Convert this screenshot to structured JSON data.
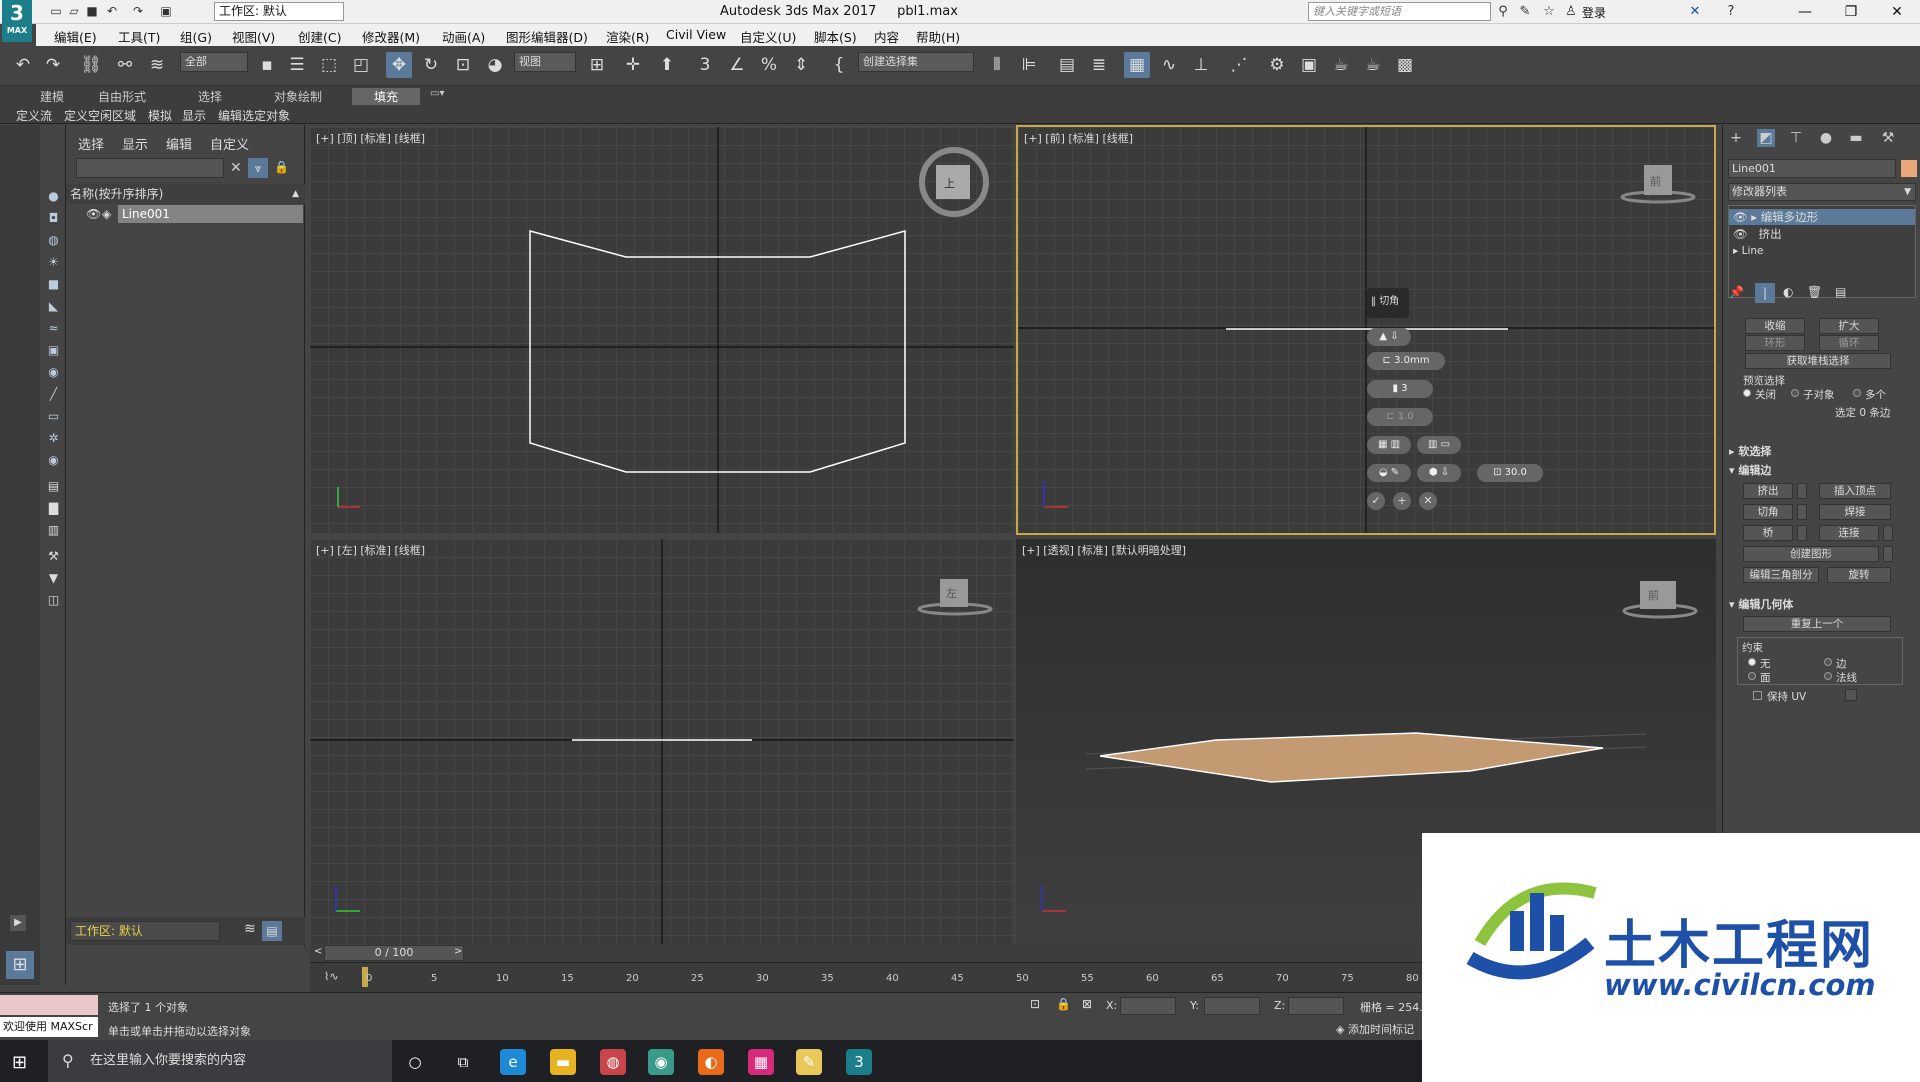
{
  "app": {
    "icon_text": "3",
    "icon_sub": "MAX",
    "title": "Autodesk 3ds Max 2017",
    "file": "pbl1.max",
    "workspace": "工作区: 默认",
    "search_placeholder": "键入关键字或短语",
    "login": "登录"
  },
  "menu": [
    "编辑(E)",
    "工具(T)",
    "组(G)",
    "视图(V)",
    "创建(C)",
    "修改器(M)",
    "动画(A)",
    "图形编辑器(D)",
    "渲染(R)",
    "Civil View",
    "自定义(U)",
    "脚本(S)",
    "内容",
    "帮助(H)"
  ],
  "toolbar": {
    "filter": "全部",
    "ref_coord": "视图",
    "named_sel": "创建选择集"
  },
  "ribbon_tabs": [
    "建模",
    "自由形式",
    "选择",
    "对象绘制",
    "填充"
  ],
  "ribbon_active": "填充",
  "ribbon_items": [
    "定义流",
    "定义空闲区域",
    "模拟",
    "显示",
    "编辑选定对象"
  ],
  "scene": {
    "tabs": [
      "选择",
      "显示",
      "编辑",
      "自定义"
    ],
    "header": "名称(按升序排序)",
    "object": "Line001",
    "workspace": "工作区: 默认"
  },
  "viewports": {
    "top": "[+] [顶] [标准] [线框]",
    "front": "[+] [前] [标准] [线框]",
    "left": "[+] [左] [标准] [线框]",
    "persp": "[+] [透视] [标准] [默认明暗处理]",
    "cube_top": "上",
    "cube_front": "前",
    "cube_left": "左",
    "cube_persp": "前"
  },
  "caddy": {
    "title": "切角",
    "amount": "3.0mm",
    "segments": "3",
    "tension": "1.0",
    "angle": "30.0"
  },
  "timeline": {
    "frame": "0 / 100",
    "ticks": [
      "0",
      "5",
      "10",
      "15",
      "20",
      "25",
      "30",
      "35",
      "40",
      "45",
      "50",
      "55",
      "60",
      "65",
      "70",
      "75",
      "80"
    ]
  },
  "status": {
    "message1": "选择了 1 个对象",
    "message2": "单击或单击并拖动以选择对象",
    "x_label": "X:",
    "y_label": "Y:",
    "z_label": "Z:",
    "grid": "栅格 = 254.0",
    "add_time_tag": "添加时间标记",
    "listener": "欢迎使用 MAXScr"
  },
  "panel": {
    "object_name": "Line001",
    "modifier_list": "修改器列表",
    "stack": [
      "编辑多边形",
      "挤出",
      "Line"
    ],
    "btn_shrink": "收缩",
    "btn_grow": "扩大",
    "btn_ring": "环形",
    "btn_loop": "循环",
    "btn_get_stack": "获取堆栈选择",
    "preview_label": "预览选择",
    "preview_opts": [
      "关闭",
      "子对象",
      "多个"
    ],
    "selected_text": "选定 0 条边",
    "soft_sel": "软选择",
    "edit_edges": "编辑边",
    "edge_btns": [
      "挤出",
      "插入顶点",
      "切角",
      "焊接",
      "桥",
      "连接",
      "创建图形",
      "编辑三角剖分",
      "旋转"
    ],
    "edit_geo": "编辑几何体",
    "repeat_last": "重复上一个",
    "constraints": "约束",
    "constraint_opts": [
      "无",
      "边",
      "面",
      "法线"
    ],
    "preserve_uv": "保持 UV"
  },
  "taskbar": {
    "search": "在这里输入你要搜索的内容"
  },
  "watermark": {
    "title": "土木工程网",
    "url": "www.civilcn.com"
  }
}
